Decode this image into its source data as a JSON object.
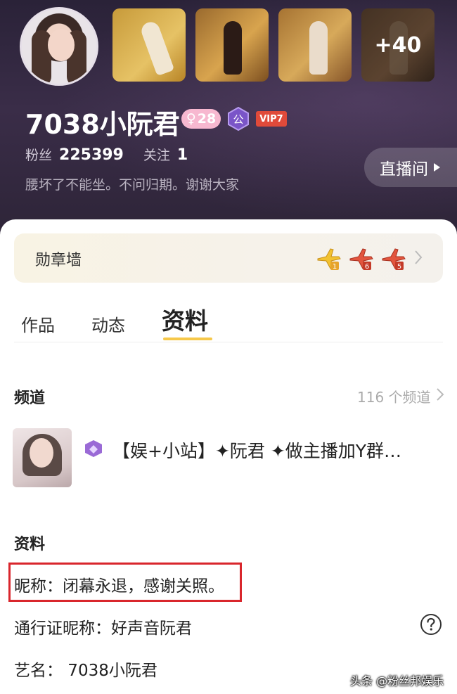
{
  "profile": {
    "username": "7038小阮君",
    "gender_age": "28",
    "gender_symbol": "♀",
    "public_badge": "公",
    "vip_badge": "VIP7",
    "fans_label": "粉丝",
    "fans_count": "225399",
    "following_label": "关注",
    "following_count": "1",
    "bio": "腰坏了不能坐。不问归期。谢谢大家",
    "live_button": "直播间",
    "more_photos": "+40"
  },
  "medal_wall": {
    "title": "勋章墙",
    "medals": [
      "plane-gold-medal-icon",
      "plane-red-medal-icon",
      "plane-red-medal-icon"
    ],
    "medal_levels": [
      "1",
      "6",
      "5"
    ]
  },
  "tabs": [
    "作品",
    "动态",
    "资料"
  ],
  "active_tab": "资料",
  "channel": {
    "section_title": "频道",
    "count_text": "116 个频道",
    "name": "【娱+小站】✦阮君 ✦做主播加Y群…"
  },
  "info": {
    "section_title": "资料",
    "nickname_line": "昵称：闭幕永退，感谢关照。",
    "pass_nickname_line": "通行证昵称：好声音阮君",
    "stage_name_line": "艺名：  7038小阮君"
  },
  "watermark": "头条 @粉丝邦娱乐",
  "colors": {
    "header_bg": "#2d2437",
    "accent_yellow": "#f6c84a",
    "highlight_red": "#d9262c",
    "vip_red": "#e04a3a",
    "gender_pink": "#f7b8d0"
  }
}
